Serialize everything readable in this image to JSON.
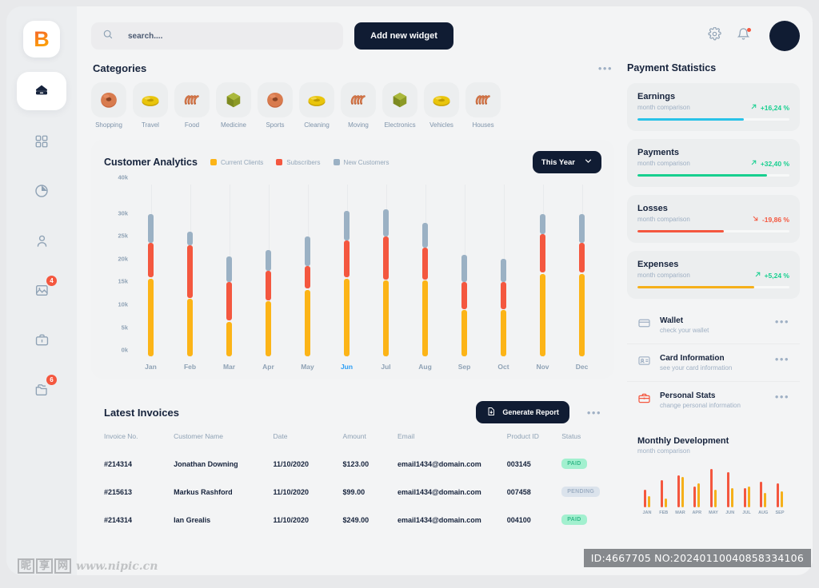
{
  "brand": {
    "logo_text": "B"
  },
  "sidebar": {
    "items": [
      {
        "name": "home",
        "icon": "home-icon",
        "active": true,
        "badge": null
      },
      {
        "name": "dashboard",
        "icon": "grid-icon",
        "active": false,
        "badge": null
      },
      {
        "name": "analytics",
        "icon": "pie-chart-icon",
        "active": false,
        "badge": null
      },
      {
        "name": "profile",
        "icon": "user-icon",
        "active": false,
        "badge": null
      },
      {
        "name": "reports",
        "icon": "image-chart-icon",
        "active": false,
        "badge": "4"
      },
      {
        "name": "briefcase",
        "icon": "briefcase-icon",
        "active": false,
        "badge": null
      },
      {
        "name": "files",
        "icon": "folders-icon",
        "active": false,
        "badge": "6"
      }
    ]
  },
  "topbar": {
    "search_placeholder": "search....",
    "search_value": "",
    "add_widget_label": "Add new widget",
    "settings_icon": "gear-icon",
    "notifications_icon": "bell-icon",
    "avatar": "avatar"
  },
  "categories": {
    "title": "Categories",
    "menu": "•••",
    "items": [
      {
        "label": "Shopping",
        "icon": "donut-orange-icon"
      },
      {
        "label": "Travel",
        "icon": "ring-yellow-icon"
      },
      {
        "label": "Food",
        "icon": "spiral-orange-icon"
      },
      {
        "label": "Medicine",
        "icon": "polygon-olive-icon"
      },
      {
        "label": "Sports",
        "icon": "donut-orange-icon"
      },
      {
        "label": "Cleaning",
        "icon": "ring-yellow-icon"
      },
      {
        "label": "Moving",
        "icon": "spiral-orange-icon"
      },
      {
        "label": "Electronics",
        "icon": "polygon-olive-icon"
      },
      {
        "label": "Vehicles",
        "icon": "ring-yellow-icon"
      },
      {
        "label": "Houses",
        "icon": "spiral-orange-icon"
      }
    ]
  },
  "analytics": {
    "title": "Customer Analytics",
    "range_label": "This Year"
  },
  "chart_data": {
    "type": "bar",
    "title": "Customer Analytics",
    "xlabel": "",
    "ylabel": "",
    "ylim": [
      0,
      40000
    ],
    "grid": true,
    "legend_position": "top",
    "highlight_category": "Jun",
    "tick_labels": [
      "0k",
      "5k",
      "10k",
      "15k",
      "20k",
      "25k",
      "30k",
      "40k"
    ],
    "tick_values": [
      0,
      5000,
      10000,
      15000,
      20000,
      25000,
      30000,
      40000
    ],
    "categories": [
      "Jan",
      "Feb",
      "Mar",
      "Apr",
      "May",
      "Jun",
      "Jul",
      "Aug",
      "Sep",
      "Oct",
      "Nov",
      "Dec"
    ],
    "series": [
      {
        "name": "Current Clients",
        "color": "#fcb417",
        "values": [
          17000,
          12500,
          7500,
          12000,
          14500,
          17000,
          16500,
          16500,
          10000,
          10000,
          18000,
          18000
        ]
      },
      {
        "name": "Subscribers",
        "color": "#f4573f",
        "values": [
          7500,
          11500,
          8500,
          6500,
          5000,
          8000,
          9500,
          7000,
          6000,
          6000,
          8500,
          6500
        ]
      },
      {
        "name": "New Customers",
        "color": "#9bb1c4",
        "values": [
          6500,
          3000,
          5500,
          4500,
          6500,
          7000,
          6500,
          5500,
          6000,
          5000,
          4500,
          6500
        ]
      }
    ]
  },
  "invoices": {
    "title": "Latest Invoices",
    "generate_label": "Generate Report",
    "menu": "•••",
    "columns": [
      "Invoice No.",
      "Customer Name",
      "Date",
      "Amount",
      "Email",
      "Product ID",
      "Status"
    ],
    "rows": [
      {
        "invoice_no": "#214314",
        "customer": "Jonathan Downing",
        "date": "11/10/2020",
        "amount": "$123.00",
        "email": "email1434@domain.com",
        "product_id": "003145",
        "status": "PAID",
        "status_kind": "paid"
      },
      {
        "invoice_no": "#215613",
        "customer": "Markus Rashford",
        "date": "11/10/2020",
        "amount": "$99.00",
        "email": "email1434@domain.com",
        "product_id": "007458",
        "status": "PENDING",
        "status_kind": "pending"
      },
      {
        "invoice_no": "#214314",
        "customer": "Ian Grealis",
        "date": "11/10/2020",
        "amount": "$249.00",
        "email": "email1434@domain.com",
        "product_id": "004100",
        "status": "PAID",
        "status_kind": "paid"
      }
    ]
  },
  "payment_statistics": {
    "title": "Payment Statistics",
    "cards": [
      {
        "name": "Earnings",
        "sub": "month comparison",
        "delta": "+16,24 %",
        "direction": "up",
        "delta_color": "#17cf8f",
        "bar_color": "#29c2e8",
        "fill_pct": 70
      },
      {
        "name": "Payments",
        "sub": "month comparison",
        "delta": "+32,40 %",
        "direction": "up",
        "delta_color": "#17cf8f",
        "bar_color": "#17cf8f",
        "fill_pct": 85
      },
      {
        "name": "Losses",
        "sub": "month comparison",
        "delta": "-19,86 %",
        "direction": "down",
        "delta_color": "#f4573f",
        "bar_color": "#f4573f",
        "fill_pct": 57
      },
      {
        "name": "Expenses",
        "sub": "month comparison",
        "delta": "+5,24 %",
        "direction": "up",
        "delta_color": "#17cf8f",
        "bar_color": "#f5b01a",
        "fill_pct": 77
      }
    ]
  },
  "quick_links": {
    "menu": "•••",
    "items": [
      {
        "title": "Wallet",
        "sub": "check your wallet",
        "icon": "wallet-card-icon",
        "icon_color": "#9fb0c4"
      },
      {
        "title": "Card Information",
        "sub": "see your card information",
        "icon": "id-card-icon",
        "icon_color": "#9fb0c4"
      },
      {
        "title": "Personal Stats",
        "sub": "change personal information",
        "icon": "briefcase-icon",
        "icon_color": "#f4573f"
      }
    ]
  },
  "monthly_development": {
    "title": "Monthly Development",
    "sub": "month comparison",
    "chart": {
      "type": "bar",
      "categories": [
        "JAN",
        "FEB",
        "MAR",
        "APR",
        "MAY",
        "JUN",
        "JUL",
        "AUG",
        "SEP"
      ],
      "series": [
        {
          "name": "primary",
          "color": "#f4573f",
          "values": [
            22,
            34,
            40,
            26,
            48,
            44,
            24,
            32,
            30
          ]
        },
        {
          "name": "secondary",
          "color": "#f5b01a",
          "values": [
            14,
            11,
            38,
            30,
            22,
            24,
            26,
            18,
            20
          ]
        }
      ]
    }
  },
  "watermark": {
    "cn_chars": [
      "昵",
      "享",
      "网"
    ],
    "url": "www.nipic.cn",
    "id_text": "ID:4667705 NO:20240110040858334106"
  }
}
